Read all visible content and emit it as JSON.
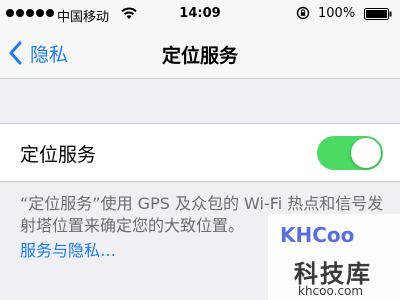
{
  "status_bar": {
    "carrier": "中国移动",
    "time": "14:09",
    "battery": "100%"
  },
  "nav": {
    "back_label": "隐私",
    "title": "定位服务"
  },
  "settings": {
    "location_services_label": "定位服务",
    "toggle_on": true
  },
  "footer": {
    "description": "“定位服务”使用 GPS 及众包的 Wi-Fi 热点和信号发射塔位置来确定您的大致位置。",
    "link": "服务与隐私…"
  },
  "watermark": {
    "logo_text": "KHCoo",
    "name": "科技库",
    "url": "khcoo.com"
  },
  "colors": {
    "accent": "#1b7cf4",
    "toggle_on": "#4cd964",
    "background": "#efeff4",
    "secondary_text": "#6d6d72"
  },
  "icons": [
    "signal-dots-icon",
    "wifi-icon",
    "rotation-lock-icon",
    "battery-icon",
    "chevron-left-icon"
  ]
}
